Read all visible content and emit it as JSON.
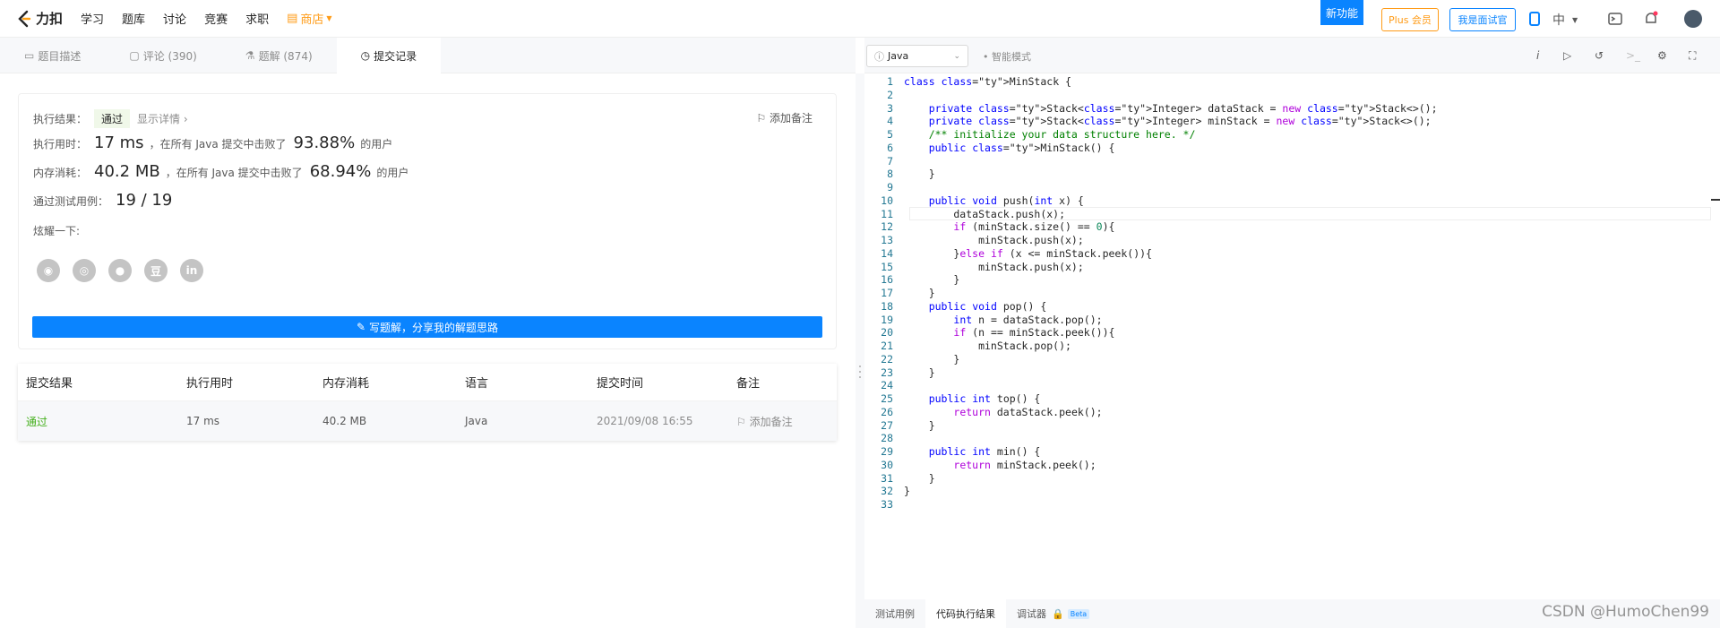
{
  "nav": {
    "logo": "力扣",
    "links": [
      "学习",
      "题库",
      "讨论",
      "竞赛",
      "求职"
    ],
    "shop": "商店",
    "new_feature": "新功能",
    "plus_member": "Plus 会员",
    "interviewer": "我是面试官",
    "lang": "中"
  },
  "tabs": [
    {
      "label": "题目描述"
    },
    {
      "label": "评论 (390)"
    },
    {
      "label": "题解 (874)"
    },
    {
      "label": "提交记录"
    }
  ],
  "result": {
    "status_label": "执行结果：",
    "status": "通过",
    "show_detail": "显示详情 ›",
    "add_note": "添加备注",
    "time_label": "执行用时：",
    "time_value": "17 ms",
    "time_mid": "，在所有 Java 提交中击败了",
    "time_pct": "93.88%",
    "time_suffix": "的用户",
    "mem_label": "内存消耗：",
    "mem_value": "40.2 MB",
    "mem_mid": "，在所有 Java 提交中击败了",
    "mem_pct": "68.94%",
    "mem_suffix": "的用户",
    "tests_label": "通过测试用例：",
    "tests_value": "19 / 19",
    "share_label": "炫耀一下:",
    "write_solution": "写题解，分享我的解题思路"
  },
  "submissions": {
    "headers": [
      "提交结果",
      "执行用时",
      "内存消耗",
      "语言",
      "提交时间",
      "备注"
    ],
    "rows": [
      {
        "result": "通过",
        "time": "17 ms",
        "memory": "40.2 MB",
        "language": "Java",
        "submitted": "2021/09/08 16:55",
        "note": "添加备注"
      }
    ]
  },
  "editor": {
    "language": "Java",
    "smart_mode": "智能模式",
    "code_lines": [
      "class MinStack {",
      "",
      "    private Stack<Integer> dataStack = new Stack<>();",
      "    private Stack<Integer> minStack = new Stack<>();",
      "    /** initialize your data structure here. */",
      "    public MinStack() {",
      "",
      "    }",
      "",
      "    public void push(int x) {",
      "        dataStack.push(x);",
      "        if (minStack.size() == 0){",
      "            minStack.push(x);",
      "        }else if (x <= minStack.peek()){",
      "            minStack.push(x);",
      "        }",
      "    }",
      "    public void pop() {",
      "        int n = dataStack.pop();",
      "        if (n == minStack.peek()){",
      "            minStack.pop();",
      "        }",
      "    }",
      "",
      "    public int top() {",
      "        return dataStack.peek();",
      "    }",
      "",
      "    public int min() {",
      "        return minStack.peek();",
      "    }",
      "}",
      ""
    ]
  },
  "bottom_tabs": [
    "测试用例",
    "代码执行结果",
    "调试器"
  ],
  "beta": "Beta",
  "watermark": "CSDN @HumoChen99",
  "colors": {
    "accent": "#0a84ff",
    "success": "#45b01d",
    "shop": "#ff9b16"
  }
}
